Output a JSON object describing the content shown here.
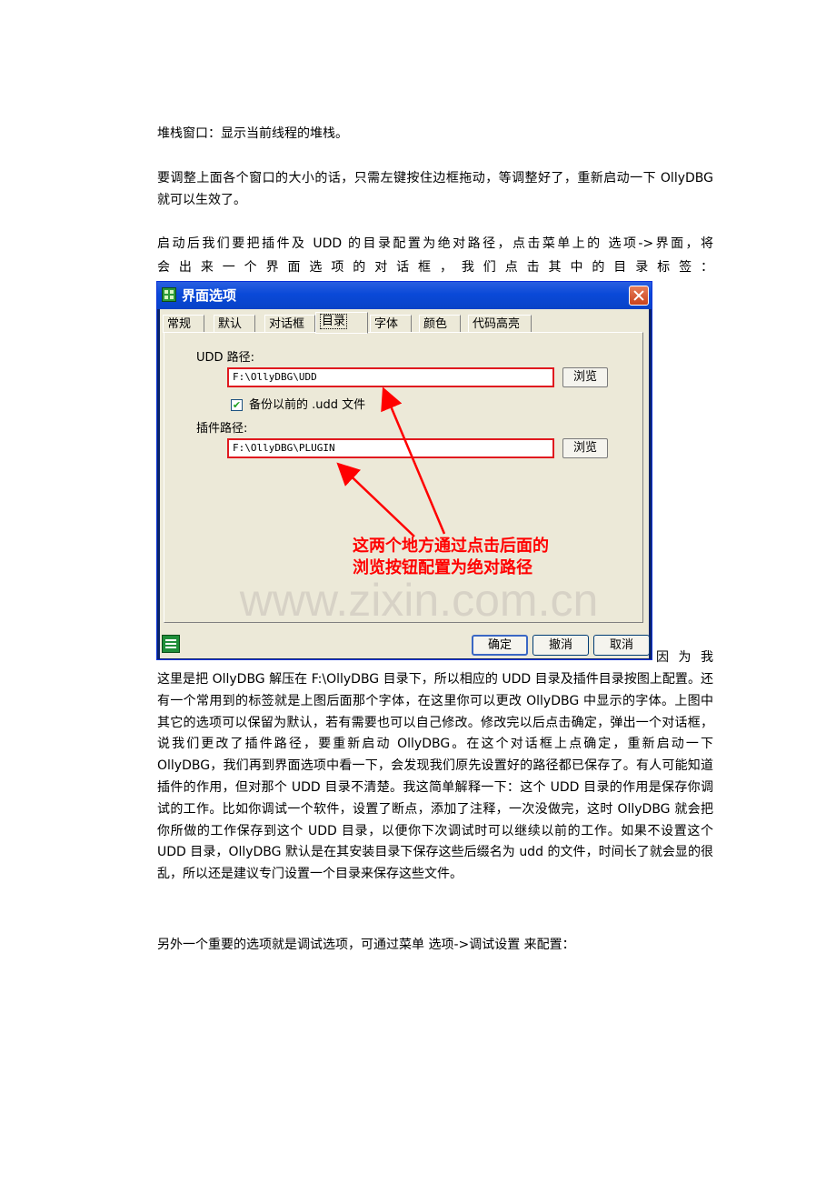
{
  "paragraphs": {
    "p1": "堆栈窗口：显示当前线程的堆栈。",
    "p2": "要调整上面各个窗口的大小的话，只需左键按住边框拖动，等调整好了，重新启动一下 OllyDBG 就可以生效了。",
    "p3_line1": "启动后我们要把插件及 UDD 的目录配置为绝对路径，点击菜单上的 选项->界面，将",
    "p3_line2": "会 出 来 一 个 界 面 选 项 的 对 话 框 ， 我 们 点 击 其 中 的 目 录 标 签 ：",
    "p4_start": "因 为 我",
    "p4": "这里是把 OllyDBG 解压在 F:\\OllyDBG 目录下，所以相应的 UDD 目录及插件目录按图上配置。还有一个常用到的标签就是上图后面那个字体，在这里你可以更改 OllyDBG 中显示的字体。上图中其它的选项可以保留为默认，若有需要也可以自己修改。修改完以后点击确定，弹出一个对话框，说我们更改了插件路径，要重新启动 OllyDBG。在这个对话框上点确定，重新启动一下 OllyDBG，我们再到界面选项中看一下，会发现我们原先设置好的路径都已保存了。有人可能知道插件的作用，但对那个 UDD 目录不清楚。我这简单解释一下：这个 UDD 目录的作用是保存你调试的工作。比如你调试一个软件，设置了断点，添加了注释，一次没做完，这时 OllyDBG 就会把你所做的工作保存到这个 UDD 目录，以便你下次调试时可以继续以前的工作。如果不设置这个 UDD 目录，OllyDBG 默认是在其安装目录下保存这些后缀名为 udd 的文件，时间长了就会显的很乱，所以还是建议专门设置一个目录来保存这些文件。",
    "p5": "另外一个重要的选项就是调试选项，可通过菜单 选项->调试设置 来配置："
  },
  "dialog": {
    "title": "界面选项",
    "tabs": [
      "常规",
      "默认",
      "对话框",
      "目录",
      "字体",
      "颜色",
      "代码高亮"
    ],
    "active_tab": "目录",
    "udd_label": "UDD 路径:",
    "udd_value": "F:\\OllyDBG\\UDD",
    "browse_label": "浏览",
    "backup_checkbox_label": "备份以前的 .udd 文件",
    "backup_checked": true,
    "plugin_label": "插件路径:",
    "plugin_value": "F:\\OllyDBG\\PLUGIN",
    "annotation_line1": "这两个地方通过点击后面的",
    "annotation_line2": "浏览按钮配置为绝对路径",
    "watermark": "www.zixin.com.cn",
    "ok_label": "确定",
    "undo_label": "撤消",
    "cancel_label": "取消",
    "highlight_color": "#e0191f",
    "titlebar_color": "#0a49d8"
  }
}
